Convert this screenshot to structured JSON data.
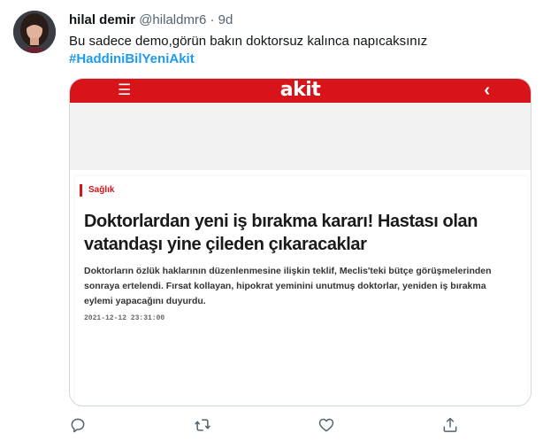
{
  "tweet": {
    "display_name": "hilal demir",
    "handle": "@hilaldmr6",
    "separator": "·",
    "time_ago": "9d",
    "text": "Bu sadece demo,görün bakın  doktorsuz kalınca napıcaksınız",
    "hashtag": "#HaddiniBilYeniAkit"
  },
  "media": {
    "site_bar": {
      "menu_icon": "☰",
      "logo": "akit",
      "back_icon": "‹",
      "color": "#d7141a"
    },
    "article": {
      "category": "Sağlık",
      "headline_line1": "Doktorlardan yeni iş bırakma kararı! Hastası olan",
      "headline_line2": "vatandaşı yine çileden çıkaracaklar",
      "summary_line1": "Doktorların özlük haklarının düzenlenmesine ilişkin teklif, Meclis'teki bütçe görüşmelerinden",
      "summary_line2": "sonraya ertelendi. Fırsat kollayan, hipokrat yeminini unutmuş doktorlar, yeniden iş bırakma",
      "summary_line3": "eylemi yapacağını duyurdu.",
      "timestamp": "2021-12-12 23:31:00"
    }
  },
  "actions": [
    {
      "icon": "reply-icon"
    },
    {
      "icon": "retweet-icon"
    },
    {
      "icon": "like-icon"
    },
    {
      "icon": "share-icon"
    }
  ],
  "colors": {
    "link": "#1d9bf0",
    "muted": "#536471",
    "brand_red": "#d7141a"
  }
}
